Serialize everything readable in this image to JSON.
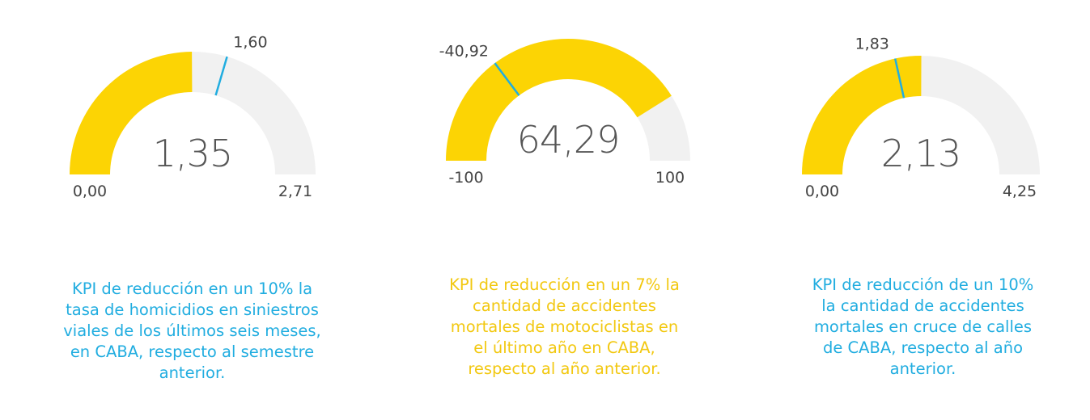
{
  "colors": {
    "fill": "#FCD404",
    "track": "#F1F1F1",
    "target": "#21ADE0",
    "text": "#555555",
    "desc_blue": "#21ADE0",
    "desc_yellow": "#F2C811"
  },
  "chart_data": [
    {
      "type": "gauge",
      "value": 1.35,
      "value_label": "1,35",
      "min": 0,
      "min_label": "0,00",
      "max": 2.71,
      "max_label": "2,71",
      "target": 1.6,
      "target_label": "1,60",
      "description": "KPI de reducción en un 10% la\ntasa de homicidios en siniestros\nviales de los últimos seis meses,\nen CABA, respecto al semestre\nanterior.",
      "description_color": "blue"
    },
    {
      "type": "gauge",
      "value": 64.29,
      "value_label": "64,29",
      "min": -100,
      "min_label": "-100",
      "max": 100,
      "max_label": "100",
      "target": -40.92,
      "target_label": "-40,92",
      "description": "KPI de reducción en un 7% la\ncantidad de accidentes\nmortales de motociclistas en\nel último año en CABA,\nrespecto al año anterior.",
      "description_color": "yellow"
    },
    {
      "type": "gauge",
      "value": 2.13,
      "value_label": "2,13",
      "min": 0,
      "min_label": "0,00",
      "max": 4.25,
      "max_label": "4,25",
      "target": 1.83,
      "target_label": "1,83",
      "description": "KPI de reducción de un 10%\nla cantidad de accidentes\nmortales en cruce de calles\nde CABA, respecto al año\nanterior.",
      "description_color": "blue"
    }
  ]
}
